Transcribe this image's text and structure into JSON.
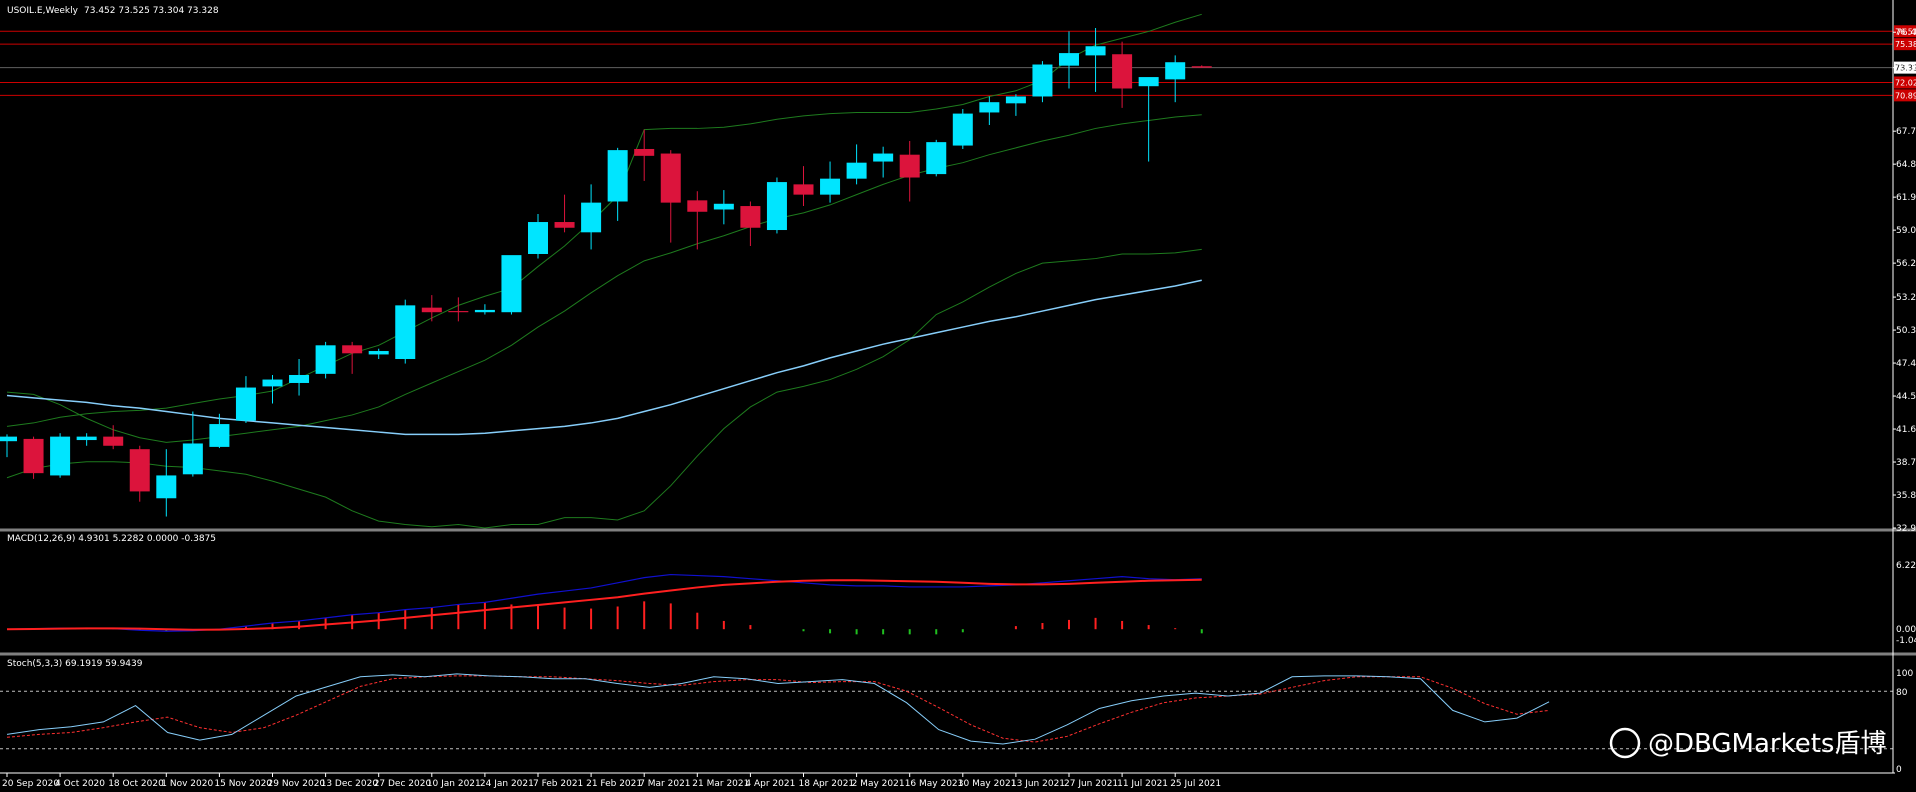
{
  "header": {
    "symbol": "USOIL.E,Weekly",
    "ohlc": "73.452 73.525 73.304 73.328"
  },
  "macd_header": "MACD(12,26,9) 4.9301 5.2282 0.0000 -0.3875",
  "stoch_header": "Stoch(5,3,3) 69.1919 59.9439",
  "watermark": "@DBGMarkets盾博",
  "colors": {
    "bg": "#000000",
    "bull": "#00e5ff",
    "bear": "#dc143c",
    "band": "#1e7b1e",
    "sma": "#87cefa",
    "macd_line": "#1010d0",
    "macd_signal": "#ff2020",
    "stoch_main": "#87cefa",
    "stoch_signal": "#ff3030",
    "level": "#cc0000",
    "panel_sep": "#808080"
  },
  "chart_data": [
    {
      "type": "candlestick",
      "title": "USOIL.E,Weekly",
      "ylim": [
        32.995,
        77.5
      ],
      "y_ticks": [
        "76.430",
        "73.328",
        "67.760",
        "64.870",
        "61.980",
        "59.090",
        "56.200",
        "53.225",
        "50.335",
        "47.445",
        "44.555",
        "41.665",
        "38.775",
        "35.885",
        "32.995"
      ],
      "x_labels": [
        "20 Sep 2020",
        "4 Oct 2020",
        "18 Oct 2020",
        "1 Nov 2020",
        "15 Nov 2020",
        "29 Nov 2020",
        "13 Dec 2020",
        "27 Dec 2020",
        "10 Jan 2021",
        "24 Jan 2021",
        "7 Feb 2021",
        "21 Feb 2021",
        "7 Mar 2021",
        "21 Mar 2021",
        "4 Apr 2021",
        "18 Apr 2021",
        "2 May 2021",
        "16 May 2021",
        "30 May 2021",
        "13 Jun 2021",
        "27 Jun 2021",
        "11 Jul 2021",
        "25 Jul 2021"
      ],
      "candles": [
        {
          "o": 40.6,
          "h": 41.2,
          "l": 39.2,
          "c": 41.0
        },
        {
          "o": 40.8,
          "h": 41.0,
          "l": 37.3,
          "c": 37.8
        },
        {
          "o": 37.6,
          "h": 41.3,
          "l": 37.4,
          "c": 41.0
        },
        {
          "o": 40.7,
          "h": 41.3,
          "l": 40.2,
          "c": 41.0
        },
        {
          "o": 41.0,
          "h": 42.0,
          "l": 39.9,
          "c": 40.2
        },
        {
          "o": 39.9,
          "h": 40.2,
          "l": 35.3,
          "c": 36.2
        },
        {
          "o": 35.6,
          "h": 39.9,
          "l": 34.0,
          "c": 37.6
        },
        {
          "o": 37.7,
          "h": 43.2,
          "l": 37.5,
          "c": 40.4
        },
        {
          "o": 40.1,
          "h": 43.0,
          "l": 40.0,
          "c": 42.1
        },
        {
          "o": 42.4,
          "h": 46.3,
          "l": 42.2,
          "c": 45.3
        },
        {
          "o": 45.4,
          "h": 46.4,
          "l": 43.9,
          "c": 46.0
        },
        {
          "o": 45.7,
          "h": 47.8,
          "l": 44.6,
          "c": 46.4
        },
        {
          "o": 46.5,
          "h": 49.3,
          "l": 46.1,
          "c": 49.0
        },
        {
          "o": 49.0,
          "h": 49.3,
          "l": 46.5,
          "c": 48.3
        },
        {
          "o": 48.2,
          "h": 48.7,
          "l": 47.8,
          "c": 48.5
        },
        {
          "o": 47.8,
          "h": 53.0,
          "l": 47.4,
          "c": 52.5
        },
        {
          "o": 52.3,
          "h": 53.4,
          "l": 51.1,
          "c": 51.9
        },
        {
          "o": 52.0,
          "h": 53.2,
          "l": 51.1,
          "c": 51.9
        },
        {
          "o": 51.9,
          "h": 52.6,
          "l": 51.7,
          "c": 52.1
        },
        {
          "o": 51.9,
          "h": 56.7,
          "l": 51.7,
          "c": 56.9
        },
        {
          "o": 57.0,
          "h": 60.5,
          "l": 56.6,
          "c": 59.8
        },
        {
          "o": 59.8,
          "h": 62.2,
          "l": 58.9,
          "c": 59.3
        },
        {
          "o": 58.9,
          "h": 63.1,
          "l": 57.4,
          "c": 61.5
        },
        {
          "o": 61.6,
          "h": 66.3,
          "l": 59.9,
          "c": 66.1
        },
        {
          "o": 66.2,
          "h": 67.9,
          "l": 63.4,
          "c": 65.6
        },
        {
          "o": 65.8,
          "h": 66.1,
          "l": 58.0,
          "c": 61.5
        },
        {
          "o": 61.7,
          "h": 62.5,
          "l": 57.4,
          "c": 60.7
        },
        {
          "o": 60.9,
          "h": 62.6,
          "l": 59.6,
          "c": 61.4
        },
        {
          "o": 61.2,
          "h": 61.6,
          "l": 57.7,
          "c": 59.3
        },
        {
          "o": 59.1,
          "h": 63.7,
          "l": 58.8,
          "c": 63.3
        },
        {
          "o": 63.1,
          "h": 64.7,
          "l": 61.2,
          "c": 62.2
        },
        {
          "o": 62.2,
          "h": 65.1,
          "l": 61.5,
          "c": 63.6
        },
        {
          "o": 63.6,
          "h": 66.6,
          "l": 63.1,
          "c": 65.0
        },
        {
          "o": 65.1,
          "h": 66.4,
          "l": 63.7,
          "c": 65.8
        },
        {
          "o": 65.7,
          "h": 66.9,
          "l": 61.6,
          "c": 63.7
        },
        {
          "o": 64.0,
          "h": 67.0,
          "l": 63.8,
          "c": 66.8
        },
        {
          "o": 66.5,
          "h": 69.7,
          "l": 66.2,
          "c": 69.3
        },
        {
          "o": 69.4,
          "h": 70.8,
          "l": 68.3,
          "c": 70.3
        },
        {
          "o": 70.2,
          "h": 71.0,
          "l": 69.1,
          "c": 70.8
        },
        {
          "o": 70.8,
          "h": 73.9,
          "l": 70.3,
          "c": 73.6
        },
        {
          "o": 73.5,
          "h": 76.5,
          "l": 71.5,
          "c": 74.6
        },
        {
          "o": 74.4,
          "h": 76.8,
          "l": 71.2,
          "c": 75.2
        },
        {
          "o": 74.5,
          "h": 75.6,
          "l": 69.8,
          "c": 71.5
        },
        {
          "o": 71.7,
          "h": 72.0,
          "l": 65.1,
          "c": 72.5
        },
        {
          "o": 72.3,
          "h": 74.4,
          "l": 70.3,
          "c": 73.8
        },
        {
          "o": 73.45,
          "h": 73.53,
          "l": 73.3,
          "c": 73.33
        }
      ],
      "overlays": [
        {
          "kind": "bollinger_upper",
          "values": [
            41.9,
            42.2,
            42.7,
            43.0,
            43.2,
            43.3,
            43.5,
            43.9,
            44.3,
            44.6,
            45.0,
            46.1,
            47.2,
            48.3,
            49.0,
            50.2,
            51.4,
            52.5,
            53.3,
            54.0,
            55.9,
            57.7,
            59.8,
            62.1,
            67.9,
            68.0,
            68.0,
            68.1,
            68.4,
            68.8,
            69.1,
            69.3,
            69.4,
            69.4,
            69.4,
            69.7,
            70.1,
            70.8,
            71.3,
            72.2,
            74.1,
            75.3,
            75.9,
            76.5,
            77.3,
            78.0
          ]
        },
        {
          "kind": "bollinger_mid",
          "values": [
            44.9,
            44.7,
            43.8,
            42.6,
            41.6,
            40.9,
            40.5,
            40.7,
            41.0,
            41.3,
            41.6,
            41.9,
            42.4,
            42.9,
            43.6,
            44.7,
            45.7,
            46.7,
            47.7,
            49.0,
            50.6,
            52.0,
            53.6,
            55.1,
            56.4,
            57.1,
            57.9,
            58.6,
            59.4,
            60.1,
            60.6,
            61.3,
            62.2,
            63.1,
            63.9,
            64.5,
            65.0,
            65.7,
            66.3,
            66.9,
            67.4,
            68.0,
            68.4,
            68.7,
            69.0,
            69.2
          ]
        },
        {
          "kind": "bollinger_lower",
          "values": [
            37.4,
            38.2,
            38.6,
            38.8,
            38.8,
            38.7,
            38.4,
            38.3,
            38.0,
            37.7,
            37.1,
            36.4,
            35.7,
            34.5,
            33.6,
            33.3,
            33.1,
            33.3,
            33.0,
            33.3,
            33.3,
            33.9,
            33.9,
            33.7,
            34.5,
            36.7,
            39.3,
            41.7,
            43.6,
            44.9,
            45.4,
            46.0,
            46.9,
            48.0,
            49.5,
            51.7,
            52.8,
            54.1,
            55.3,
            56.2,
            56.4,
            56.6,
            57.0,
            57.0,
            57.1,
            57.4
          ]
        },
        {
          "kind": "sma",
          "values": [
            44.6,
            44.4,
            44.2,
            44.0,
            43.7,
            43.5,
            43.2,
            42.9,
            42.6,
            42.4,
            42.2,
            42.0,
            41.8,
            41.6,
            41.4,
            41.2,
            41.2,
            41.2,
            41.3,
            41.5,
            41.7,
            41.9,
            42.2,
            42.6,
            43.2,
            43.8,
            44.5,
            45.2,
            45.9,
            46.6,
            47.2,
            47.9,
            48.5,
            49.1,
            49.6,
            50.1,
            50.6,
            51.1,
            51.5,
            52.0,
            52.5,
            53.0,
            53.4,
            53.8,
            54.2,
            54.7
          ]
        }
      ],
      "levels": [
        {
          "label": "76.511",
          "value": 76.511
        },
        {
          "label": "75.384",
          "value": 75.384
        },
        {
          "label": "73.328",
          "value": 73.328
        },
        {
          "label": "72.026",
          "value": 72.026
        },
        {
          "label": "70.898",
          "value": 70.898
        }
      ],
      "current_price": "73.328"
    },
    {
      "type": "macd",
      "title": "MACD(12,26,9) 4.9301 5.2282 0.0000 -0.3875",
      "ylim": [
        -1.0479,
        6.2264
      ],
      "y_ticks": [
        "6.2264",
        "0.00",
        "-1.0479"
      ],
      "macd": [
        0.0,
        0.05,
        0.1,
        0.1,
        0.05,
        -0.1,
        -0.2,
        -0.15,
        0.0,
        0.3,
        0.6,
        0.8,
        1.1,
        1.4,
        1.6,
        1.9,
        2.1,
        2.4,
        2.6,
        3.0,
        3.4,
        3.7,
        4.0,
        4.5,
        5.0,
        5.3,
        5.2,
        5.1,
        4.9,
        4.7,
        4.5,
        4.3,
        4.2,
        4.2,
        4.1,
        4.1,
        4.1,
        4.2,
        4.3,
        4.5,
        4.7,
        4.9,
        5.1,
        4.9,
        4.8,
        4.9
      ],
      "signal": [
        0.0,
        0.02,
        0.05,
        0.08,
        0.08,
        0.05,
        0.0,
        -0.05,
        -0.04,
        0.02,
        0.1,
        0.25,
        0.45,
        0.65,
        0.85,
        1.1,
        1.35,
        1.6,
        1.85,
        2.1,
        2.35,
        2.6,
        2.85,
        3.1,
        3.45,
        3.75,
        4.05,
        4.3,
        4.45,
        4.6,
        4.7,
        4.75,
        4.75,
        4.7,
        4.65,
        4.6,
        4.5,
        4.4,
        4.35,
        4.35,
        4.4,
        4.5,
        4.6,
        4.7,
        4.75,
        4.8
      ],
      "histogram": [
        0.0,
        0.05,
        0.1,
        0.1,
        0.05,
        -0.1,
        -0.2,
        -0.15,
        0.0,
        0.3,
        0.6,
        0.8,
        1.1,
        1.4,
        1.6,
        1.9,
        2.1,
        2.4,
        2.6,
        2.4,
        2.3,
        2.1,
        2.0,
        2.2,
        2.7,
        2.5,
        1.6,
        0.8,
        0.4,
        0.0,
        -0.2,
        -0.4,
        -0.5,
        -0.5,
        -0.5,
        -0.5,
        -0.3,
        0.0,
        0.3,
        0.6,
        0.9,
        1.1,
        0.8,
        0.4,
        0.1,
        -0.4
      ]
    },
    {
      "type": "stochastic",
      "title": "Stoch(5,3,3) 69.1919 59.9439",
      "ylim": [
        0,
        100
      ],
      "y_ticks": [
        "100",
        "80",
        "0"
      ],
      "levels": [
        80,
        20
      ],
      "main": [
        35,
        40,
        43,
        48,
        65,
        37,
        29,
        35,
        55,
        75,
        85,
        95,
        97,
        95,
        98,
        96,
        95,
        93,
        93,
        88,
        84,
        88,
        95,
        93,
        88,
        90,
        92,
        88,
        68,
        40,
        28,
        25,
        30,
        45,
        62,
        70,
        75,
        78,
        75,
        78,
        95,
        96,
        96,
        95,
        93,
        60,
        48,
        52,
        69
      ],
      "signal": [
        32,
        35,
        37,
        42,
        48,
        53,
        42,
        37,
        42,
        55,
        70,
        85,
        93,
        95,
        96,
        96,
        95,
        95,
        93,
        91,
        88,
        86,
        90,
        92,
        92,
        89,
        90,
        90,
        80,
        63,
        45,
        31,
        27,
        33,
        46,
        58,
        68,
        73,
        75,
        77,
        84,
        91,
        95,
        95,
        95,
        83,
        67,
        56,
        60
      ]
    }
  ]
}
